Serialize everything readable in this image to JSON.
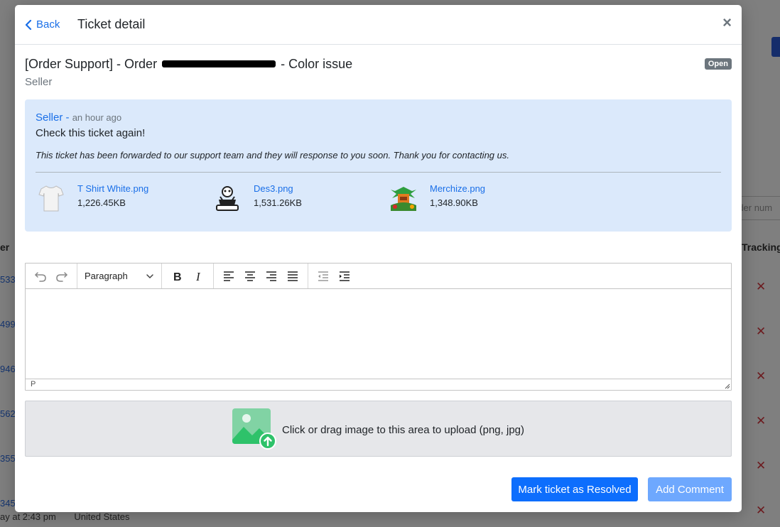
{
  "modal": {
    "back_label": "Back",
    "title": "Ticket detail",
    "close_symbol": "×"
  },
  "ticket": {
    "title_prefix": "[Order Support] - Order",
    "title_suffix": "- Color issue",
    "subtitle": "Seller",
    "status": "Open"
  },
  "comment": {
    "author": "Seller",
    "separator": " - ",
    "time": "an hour ago",
    "text": "Check this ticket again!",
    "note": "This ticket has been forwarded to our support team and they will response to you soon. Thank you for contacting us.",
    "attachments": [
      {
        "name": "T Shirt White.png",
        "size": "1,226.45KB"
      },
      {
        "name": "Des3.png",
        "size": "1,531.26KB"
      },
      {
        "name": "Merchize.png",
        "size": "1,348.90KB"
      }
    ]
  },
  "editor": {
    "block_format": "Paragraph",
    "status_path": "P"
  },
  "upload": {
    "text": "Click or drag image to this area to upload (png, jpg)"
  },
  "actions": {
    "resolve_label": "Mark ticket as Resolved",
    "add_comment_label": "Add Comment"
  },
  "background": {
    "tracking_header": "Tracking",
    "order_search_placeholder": "rder num",
    "bottom_row_time": "ay at 2:43 pm",
    "bottom_row_country": "United States"
  },
  "colors": {
    "accent": "#0d6efd",
    "accent_light": "#6ea8fe",
    "comment_bg": "#dbe9fb",
    "status_badge": "#6c757d",
    "danger": "#d9363e"
  }
}
